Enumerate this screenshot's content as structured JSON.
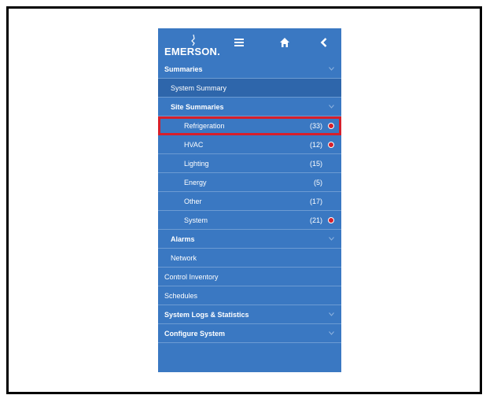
{
  "header": {
    "logo_text": "EMERSON.",
    "menu_icon": "hamburger-icon",
    "home_icon": "home-icon",
    "back_icon": "chevron-left-icon"
  },
  "nav": {
    "summaries": "Summaries",
    "system_summary": "System Summary",
    "site_summaries": "Site Summaries",
    "items": [
      {
        "label": "Refrigeration",
        "count": "(33)",
        "alert": true,
        "selected": true
      },
      {
        "label": "HVAC",
        "count": "(12)",
        "alert": true
      },
      {
        "label": "Lighting",
        "count": "(15)",
        "alert": false
      },
      {
        "label": "Energy",
        "count": "(5)",
        "alert": false
      },
      {
        "label": "Other",
        "count": "(17)",
        "alert": false
      },
      {
        "label": "System",
        "count": "(21)",
        "alert": true
      }
    ],
    "alarms": "Alarms",
    "network": "Network",
    "control_inventory": "Control Inventory",
    "schedules": "Schedules",
    "system_logs": "System Logs & Statistics",
    "configure_system": "Configure System"
  },
  "colors": {
    "panel_blue": "#3a78c2",
    "selected_row": "#2e66ab",
    "highlight_red": "#d61f2b"
  }
}
